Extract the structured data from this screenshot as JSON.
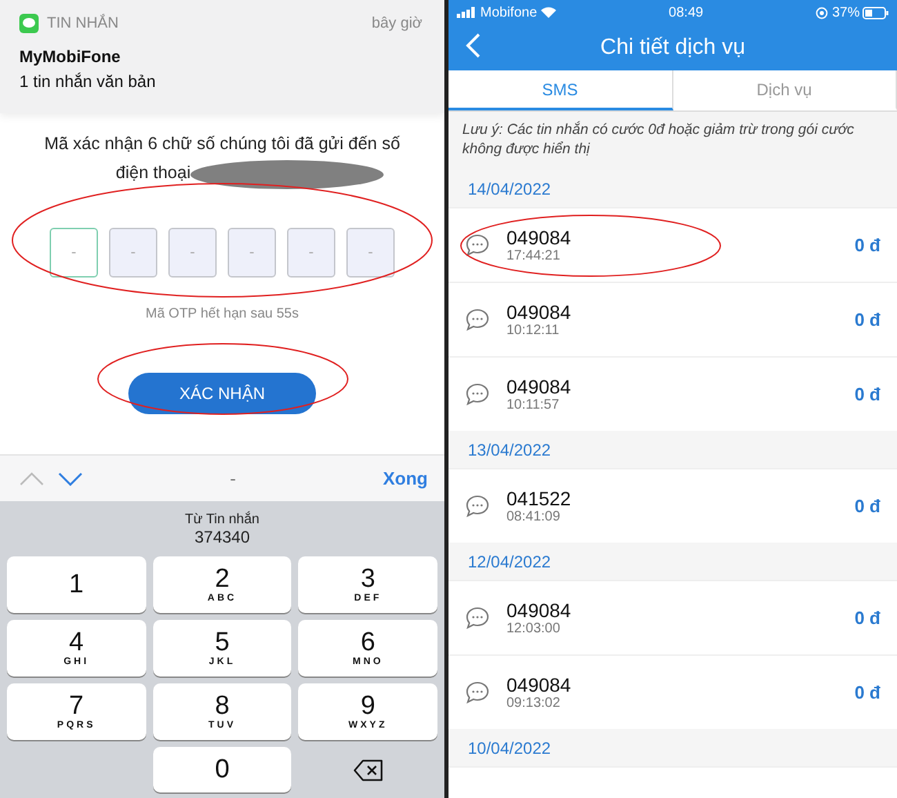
{
  "left_phone": {
    "notification": {
      "app": "TIN NHẮN",
      "time": "bây giờ",
      "sender": "MyMobiFone",
      "body": "1 tin nhắn văn bản"
    },
    "message": "Mã xác nhận 6 chữ số chúng tôi đã gửi đến số",
    "phone_label": "điện thoại",
    "otp_boxes": [
      {
        "placeholder": "-",
        "selected": true
      },
      {
        "placeholder": "-",
        "selected": false
      },
      {
        "placeholder": "-",
        "selected": false
      },
      {
        "placeholder": "-",
        "selected": false
      },
      {
        "placeholder": "-",
        "selected": false
      },
      {
        "placeholder": "-",
        "selected": false
      }
    ],
    "expiry": "Mã OTP hết hạn sau 55s",
    "confirm_button": "XÁC NHẬN",
    "toolbar": {
      "middle": "-",
      "done": "Xong"
    },
    "suggestion": {
      "label": "Từ Tin nhắn",
      "code": "374340"
    },
    "keys": [
      {
        "kind": "digit",
        "digit": "1"
      },
      {
        "kind": "digit",
        "digit": "2",
        "letters": "ABC"
      },
      {
        "kind": "digit",
        "digit": "3",
        "letters": "DEF"
      },
      {
        "kind": "digit",
        "digit": "4",
        "letters": "GHI"
      },
      {
        "kind": "digit",
        "digit": "5",
        "letters": "JKL"
      },
      {
        "kind": "digit",
        "digit": "6",
        "letters": "MNO"
      },
      {
        "kind": "digit",
        "digit": "7",
        "letters": "PQRS"
      },
      {
        "kind": "digit",
        "digit": "8",
        "letters": "TUV"
      },
      {
        "kind": "digit",
        "digit": "9",
        "letters": "WXYZ"
      },
      {
        "kind": "blank"
      },
      {
        "kind": "digit",
        "digit": "0"
      },
      {
        "kind": "delete"
      }
    ]
  },
  "right_phone": {
    "status_bar": {
      "carrier": "Mobifone",
      "time": "08:49",
      "battery": "37%"
    },
    "title": "Chi tiết dịch vụ",
    "tabs": [
      {
        "label": "SMS",
        "selected": true
      },
      {
        "label": "Dịch vụ",
        "selected": false
      }
    ],
    "note": "Lưu ý: Các tin nhắn có cước 0đ hoặc giảm trừ trong gói cước không được hiển thị",
    "groups": [
      {
        "date": "14/04/2022",
        "items": [
          {
            "number": "049084",
            "time": "17:44:21",
            "cost": "0 đ"
          },
          {
            "number": "049084",
            "time": "10:12:11",
            "cost": "0 đ"
          },
          {
            "number": "049084",
            "time": "10:11:57",
            "cost": "0 đ"
          }
        ]
      },
      {
        "date": "13/04/2022",
        "items": [
          {
            "number": "041522",
            "time": "08:41:09",
            "cost": "0 đ"
          }
        ]
      },
      {
        "date": "12/04/2022",
        "items": [
          {
            "number": "049084",
            "time": "12:03:00",
            "cost": "0 đ"
          },
          {
            "number": "049084",
            "time": "09:13:02",
            "cost": "0 đ"
          }
        ]
      },
      {
        "date": "10/04/2022"
      }
    ]
  }
}
